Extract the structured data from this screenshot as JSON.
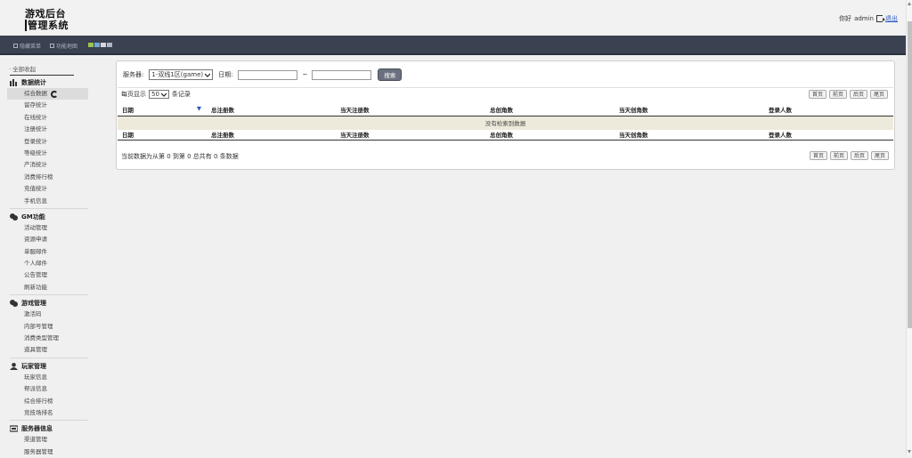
{
  "header": {
    "title_line1": "游戏后台",
    "title_line2": "管理系统",
    "greeting": "你好",
    "username": "admin",
    "logout": "退出"
  },
  "nav": {
    "hide_menu": "隐藏菜单",
    "site_map": "功能地图",
    "themes": [
      "#9fc34a",
      "#6fa7d8",
      "#d8d8d8",
      "#b0b8c8"
    ]
  },
  "sidebar": {
    "collapse_all": "· 全部收起",
    "groups": [
      {
        "title": "数据统计",
        "icon": "bar-chart-icon",
        "items": [
          "综合数据",
          "留存统计",
          "在线统计",
          "注册统计",
          "登录统计",
          "等级统计",
          "产消统计",
          "消费排行榜",
          "充值统计",
          "手机信息"
        ]
      },
      {
        "title": "GM功能",
        "icon": "chat-bubbles-icon",
        "items": [
          "活动管理",
          "资源申请",
          "单服邮件",
          "个人邮件",
          "公告管理",
          "刷新功能"
        ]
      },
      {
        "title": "游戏管理",
        "icon": "chat-bubbles-icon",
        "items": [
          "激活码",
          "内部号管理",
          "消费类型管理",
          "道具管理"
        ]
      },
      {
        "title": "玩家管理",
        "icon": "user-icon",
        "items": [
          "玩家信息",
          "帮派信息",
          "综合排行榜",
          "竞技场排名"
        ]
      },
      {
        "title": "服务器信息",
        "icon": "server-icon",
        "items": [
          "渠道管理",
          "服务器管理"
        ]
      }
    ]
  },
  "search": {
    "server_label": "服务器:",
    "server_value": "1-双线1区(game)",
    "date_label": "日期:",
    "date_sep": "~",
    "search_button": "搜索"
  },
  "table": {
    "per_page_label": "每页显示",
    "per_page_value": "50",
    "records_label": "条记录",
    "pager": [
      "首页",
      "前页",
      "后页",
      "尾页"
    ],
    "columns": [
      "日期",
      "总注册数",
      "当天注册数",
      "总创角数",
      "当天创角数",
      "登录人数"
    ],
    "empty_text": "没有检索到数据",
    "info": "当前数据为从第 0 到第 0 总共有 0 条数据"
  }
}
